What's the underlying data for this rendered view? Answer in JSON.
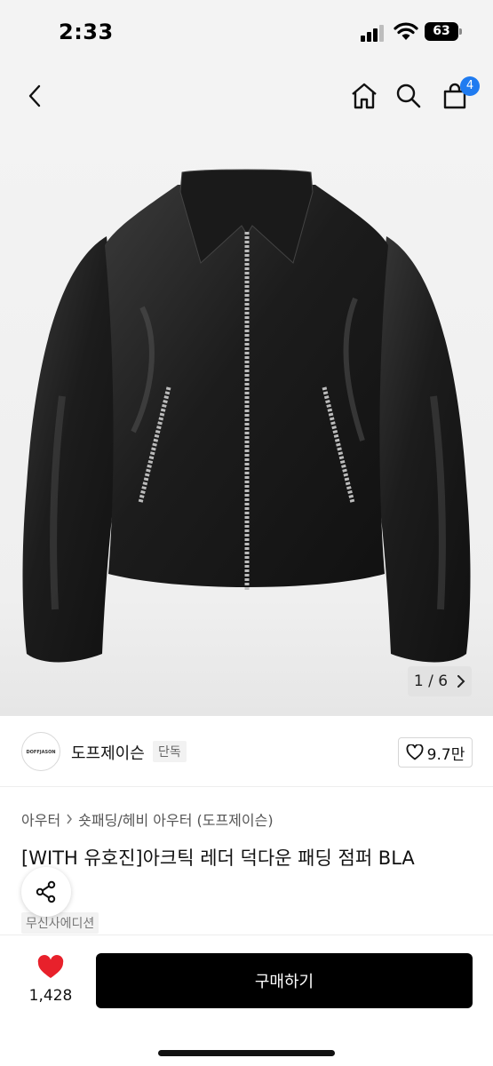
{
  "status": {
    "time": "2:33",
    "battery": "63"
  },
  "nav": {
    "cart_count": "4"
  },
  "gallery": {
    "current": "1",
    "separator": "/",
    "total": "6"
  },
  "brand": {
    "logo_text": "DOFFJASON",
    "name": "도프제이슨",
    "tag": "단독",
    "likes": "9.7만"
  },
  "breadcrumb": {
    "level1": "아우터",
    "level2": "숏패딩/헤비 아우터 (도프제이슨)"
  },
  "product": {
    "title": "[WITH 유호진]아크틱 레더 덕다운 패딩 점퍼 BLA",
    "edition_tag": "무신사에디션"
  },
  "bottom": {
    "wish_count": "1,428",
    "buy_label": "구매하기"
  },
  "colors": {
    "accent_badge": "#1f7bf0",
    "heart": "#e8212b",
    "buy_button": "#000000"
  },
  "icons": [
    "back-arrow-icon",
    "home-icon",
    "search-icon",
    "cart-icon",
    "chevron-right-icon",
    "heart-outline-icon",
    "share-icon",
    "heart-filled-icon"
  ]
}
